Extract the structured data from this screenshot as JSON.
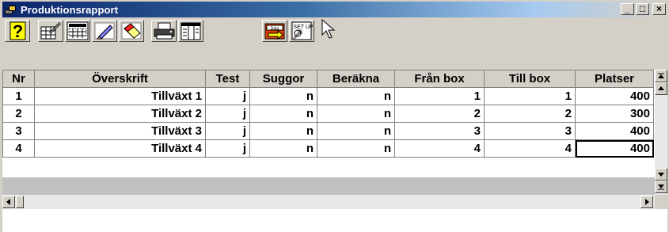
{
  "window": {
    "title": "Produktionsrapport",
    "minimize_glyph": "_",
    "maximize_glyph": "□",
    "close_glyph": "×"
  },
  "toolbar": {
    "help_glyph": "?",
    "tools": [
      {
        "icon": "edit-table-icon"
      },
      {
        "icon": "spreadsheet-icon"
      },
      {
        "icon": "pen-icon"
      },
      {
        "icon": "eraser-icon"
      },
      {
        "icon": "printer-icon"
      },
      {
        "icon": "report-view-icon"
      },
      {
        "icon": "data-export-icon"
      },
      {
        "icon": "setup-icon"
      }
    ],
    "export_label": "Data",
    "setup_label": "SET UP"
  },
  "table": {
    "columns": [
      "Nr",
      "Överskrift",
      "Test",
      "Suggor",
      "Beräkna",
      "Från box",
      "Till box",
      "Platser"
    ],
    "rows": [
      {
        "nr": "1",
        "overskrift": "Tillväxt 1",
        "test": "j",
        "suggor": "n",
        "berakna": "n",
        "fran_box": "1",
        "till_box": "1",
        "platser": "400"
      },
      {
        "nr": "2",
        "overskrift": "Tillväxt 2",
        "test": "j",
        "suggor": "n",
        "berakna": "n",
        "fran_box": "2",
        "till_box": "2",
        "platser": "300"
      },
      {
        "nr": "3",
        "overskrift": "Tillväxt 3",
        "test": "j",
        "suggor": "n",
        "berakna": "n",
        "fran_box": "3",
        "till_box": "3",
        "platser": "400"
      },
      {
        "nr": "4",
        "overskrift": "Tillväxt 4",
        "test": "j",
        "suggor": "n",
        "berakna": "n",
        "fran_box": "4",
        "till_box": "4",
        "platser": "400"
      }
    ]
  },
  "colors": {
    "titlebar_start": "#0a246a",
    "titlebar_end": "#a6caf0",
    "face": "#d4d0c8"
  }
}
